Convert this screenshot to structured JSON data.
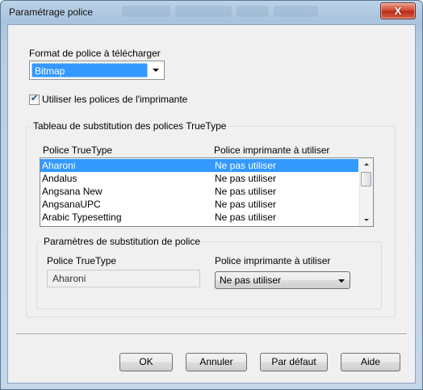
{
  "window": {
    "title": "Paramétrage police",
    "close_icon": "close-icon",
    "close_glyph": "X"
  },
  "format": {
    "label": "Format de police à télécharger",
    "selected": "Bitmap"
  },
  "use_printer_fonts": {
    "label": "Utiliser les polices de l'imprimante",
    "checked": true
  },
  "table_group": {
    "label": "Tableau de substitution des polices TrueType",
    "col1": "Police TrueType",
    "col2": "Police imprimante à utiliser",
    "rows": [
      {
        "font": "Aharoni",
        "printer_font": "Ne pas utiliser",
        "selected": true
      },
      {
        "font": "Andalus",
        "printer_font": "Ne pas utiliser"
      },
      {
        "font": "Angsana New",
        "printer_font": "Ne pas utiliser"
      },
      {
        "font": "AngsanaUPC",
        "printer_font": "Ne pas utiliser"
      },
      {
        "font": "Arabic Typesetting",
        "printer_font": "Ne pas utiliser"
      }
    ]
  },
  "sub_group": {
    "label": "Paramètres de substitution de police",
    "col1": "Police TrueType",
    "col2": "Police imprimante à utiliser",
    "font_value": "Aharoni",
    "printer_font_value": "Ne pas utiliser"
  },
  "buttons": {
    "ok": "OK",
    "cancel": "Annuler",
    "default": "Par défaut",
    "help": "Aide"
  },
  "colors": {
    "selection": "#3399ff",
    "dialog_bg": "#f0f0f0",
    "close_button": "#c4412a"
  }
}
